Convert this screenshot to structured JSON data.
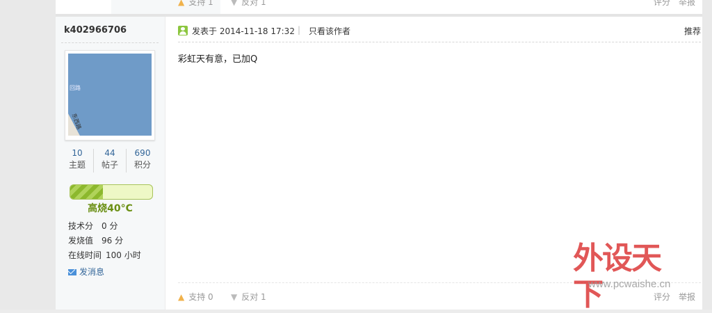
{
  "prev_post": {
    "support_label": "支持 1",
    "oppose_label": "反对 1",
    "rate_label": "评分",
    "report_label": "举报"
  },
  "author": {
    "name": "k402966706",
    "avatar_text_1": "回路",
    "avatar_text_2": "东西路",
    "stats": [
      {
        "num": "10",
        "label": "主题"
      },
      {
        "num": "44",
        "label": "帖子"
      },
      {
        "num": "690",
        "label": "积分"
      }
    ],
    "heat_label": "高烧40°C",
    "heat_level_fraction": 0.4,
    "info": [
      {
        "key": "技术分",
        "value": "0 分"
      },
      {
        "key": "发烧值",
        "value": "96 分"
      },
      {
        "key": "在线时间",
        "value": "100 小时"
      }
    ],
    "send_message_label": "发消息"
  },
  "post": {
    "posted_at": "发表于 2014-11-18 17:32",
    "separator": "|",
    "only_author_label": "只看该作者",
    "recommend_label": "推荐",
    "content": "彩虹天有意，已加Q",
    "support_label": "支持 0",
    "oppose_label": "反对 1",
    "rate_label": "评分",
    "report_label": "举报"
  },
  "watermark": {
    "brand": "外设天下",
    "url": "www.pcwaishe.cn"
  },
  "colors": {
    "link": "#336699",
    "heat": "#6a8f13",
    "watermark": "#d82828"
  }
}
